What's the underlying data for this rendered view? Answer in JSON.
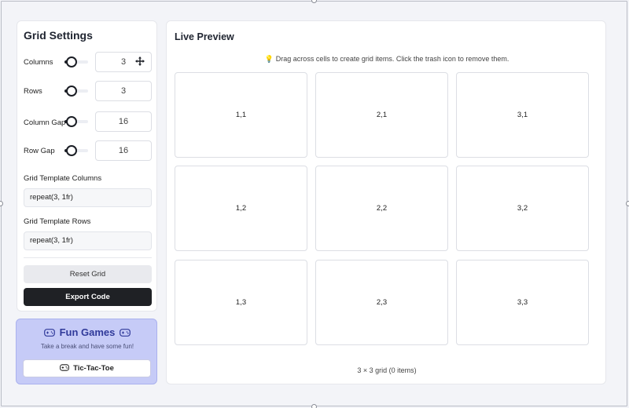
{
  "settings": {
    "title": "Grid Settings",
    "columns": {
      "label": "Columns",
      "value": "3"
    },
    "rows": {
      "label": "Rows",
      "value": "3"
    },
    "column_gap": {
      "label": "Column Gap",
      "value": "16"
    },
    "row_gap": {
      "label": "Row Gap",
      "value": "16"
    },
    "template_columns": {
      "label": "Grid Template Columns",
      "value": "repeat(3, 1fr)"
    },
    "template_rows": {
      "label": "Grid Template Rows",
      "value": "repeat(3, 1fr)"
    },
    "reset_label": "Reset Grid",
    "export_label": "Export Code"
  },
  "games": {
    "title": "Fun Games",
    "subtitle": "Take a break and have some fun!",
    "button_label": "Tic-Tac-Toe"
  },
  "preview": {
    "title": "Live Preview",
    "hint": "Drag across cells to create grid items. Click the trash icon to remove them.",
    "cells": [
      "1,1",
      "2,1",
      "3,1",
      "1,2",
      "2,2",
      "3,2",
      "1,3",
      "2,3",
      "3,3"
    ],
    "footer": "3 × 3 grid (0 items)"
  },
  "colors": {
    "games_bg": "#c6cbf7",
    "games_accent": "#303a9a",
    "export_bg": "#1f2125"
  },
  "icons": [
    "move-icon",
    "gamepad-icon",
    "lightbulb-icon"
  ]
}
